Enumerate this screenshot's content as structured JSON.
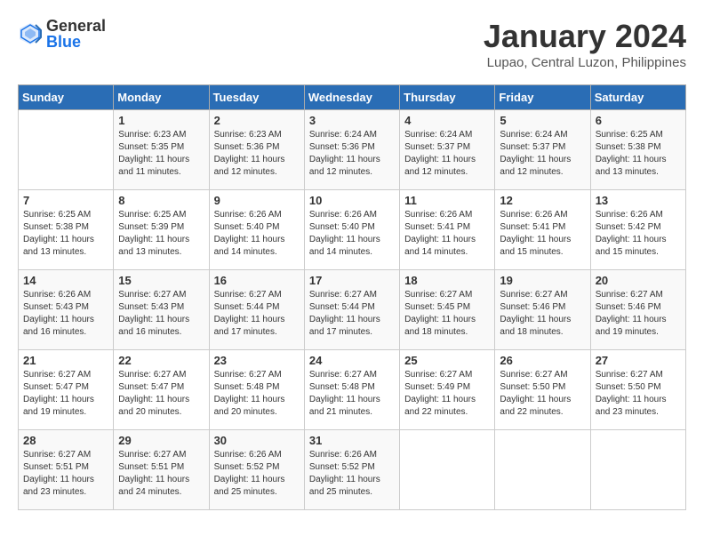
{
  "header": {
    "logo_general": "General",
    "logo_blue": "Blue",
    "month_year": "January 2024",
    "location": "Lupao, Central Luzon, Philippines"
  },
  "days_of_week": [
    "Sunday",
    "Monday",
    "Tuesday",
    "Wednesday",
    "Thursday",
    "Friday",
    "Saturday"
  ],
  "weeks": [
    [
      {
        "day": "",
        "info": ""
      },
      {
        "day": "1",
        "info": "Sunrise: 6:23 AM\nSunset: 5:35 PM\nDaylight: 11 hours\nand 11 minutes."
      },
      {
        "day": "2",
        "info": "Sunrise: 6:23 AM\nSunset: 5:36 PM\nDaylight: 11 hours\nand 12 minutes."
      },
      {
        "day": "3",
        "info": "Sunrise: 6:24 AM\nSunset: 5:36 PM\nDaylight: 11 hours\nand 12 minutes."
      },
      {
        "day": "4",
        "info": "Sunrise: 6:24 AM\nSunset: 5:37 PM\nDaylight: 11 hours\nand 12 minutes."
      },
      {
        "day": "5",
        "info": "Sunrise: 6:24 AM\nSunset: 5:37 PM\nDaylight: 11 hours\nand 12 minutes."
      },
      {
        "day": "6",
        "info": "Sunrise: 6:25 AM\nSunset: 5:38 PM\nDaylight: 11 hours\nand 13 minutes."
      }
    ],
    [
      {
        "day": "7",
        "info": "Sunrise: 6:25 AM\nSunset: 5:38 PM\nDaylight: 11 hours\nand 13 minutes."
      },
      {
        "day": "8",
        "info": "Sunrise: 6:25 AM\nSunset: 5:39 PM\nDaylight: 11 hours\nand 13 minutes."
      },
      {
        "day": "9",
        "info": "Sunrise: 6:26 AM\nSunset: 5:40 PM\nDaylight: 11 hours\nand 14 minutes."
      },
      {
        "day": "10",
        "info": "Sunrise: 6:26 AM\nSunset: 5:40 PM\nDaylight: 11 hours\nand 14 minutes."
      },
      {
        "day": "11",
        "info": "Sunrise: 6:26 AM\nSunset: 5:41 PM\nDaylight: 11 hours\nand 14 minutes."
      },
      {
        "day": "12",
        "info": "Sunrise: 6:26 AM\nSunset: 5:41 PM\nDaylight: 11 hours\nand 15 minutes."
      },
      {
        "day": "13",
        "info": "Sunrise: 6:26 AM\nSunset: 5:42 PM\nDaylight: 11 hours\nand 15 minutes."
      }
    ],
    [
      {
        "day": "14",
        "info": "Sunrise: 6:26 AM\nSunset: 5:43 PM\nDaylight: 11 hours\nand 16 minutes."
      },
      {
        "day": "15",
        "info": "Sunrise: 6:27 AM\nSunset: 5:43 PM\nDaylight: 11 hours\nand 16 minutes."
      },
      {
        "day": "16",
        "info": "Sunrise: 6:27 AM\nSunset: 5:44 PM\nDaylight: 11 hours\nand 17 minutes."
      },
      {
        "day": "17",
        "info": "Sunrise: 6:27 AM\nSunset: 5:44 PM\nDaylight: 11 hours\nand 17 minutes."
      },
      {
        "day": "18",
        "info": "Sunrise: 6:27 AM\nSunset: 5:45 PM\nDaylight: 11 hours\nand 18 minutes."
      },
      {
        "day": "19",
        "info": "Sunrise: 6:27 AM\nSunset: 5:46 PM\nDaylight: 11 hours\nand 18 minutes."
      },
      {
        "day": "20",
        "info": "Sunrise: 6:27 AM\nSunset: 5:46 PM\nDaylight: 11 hours\nand 19 minutes."
      }
    ],
    [
      {
        "day": "21",
        "info": "Sunrise: 6:27 AM\nSunset: 5:47 PM\nDaylight: 11 hours\nand 19 minutes."
      },
      {
        "day": "22",
        "info": "Sunrise: 6:27 AM\nSunset: 5:47 PM\nDaylight: 11 hours\nand 20 minutes."
      },
      {
        "day": "23",
        "info": "Sunrise: 6:27 AM\nSunset: 5:48 PM\nDaylight: 11 hours\nand 20 minutes."
      },
      {
        "day": "24",
        "info": "Sunrise: 6:27 AM\nSunset: 5:48 PM\nDaylight: 11 hours\nand 21 minutes."
      },
      {
        "day": "25",
        "info": "Sunrise: 6:27 AM\nSunset: 5:49 PM\nDaylight: 11 hours\nand 22 minutes."
      },
      {
        "day": "26",
        "info": "Sunrise: 6:27 AM\nSunset: 5:50 PM\nDaylight: 11 hours\nand 22 minutes."
      },
      {
        "day": "27",
        "info": "Sunrise: 6:27 AM\nSunset: 5:50 PM\nDaylight: 11 hours\nand 23 minutes."
      }
    ],
    [
      {
        "day": "28",
        "info": "Sunrise: 6:27 AM\nSunset: 5:51 PM\nDaylight: 11 hours\nand 23 minutes."
      },
      {
        "day": "29",
        "info": "Sunrise: 6:27 AM\nSunset: 5:51 PM\nDaylight: 11 hours\nand 24 minutes."
      },
      {
        "day": "30",
        "info": "Sunrise: 6:26 AM\nSunset: 5:52 PM\nDaylight: 11 hours\nand 25 minutes."
      },
      {
        "day": "31",
        "info": "Sunrise: 6:26 AM\nSunset: 5:52 PM\nDaylight: 11 hours\nand 25 minutes."
      },
      {
        "day": "",
        "info": ""
      },
      {
        "day": "",
        "info": ""
      },
      {
        "day": "",
        "info": ""
      }
    ]
  ]
}
